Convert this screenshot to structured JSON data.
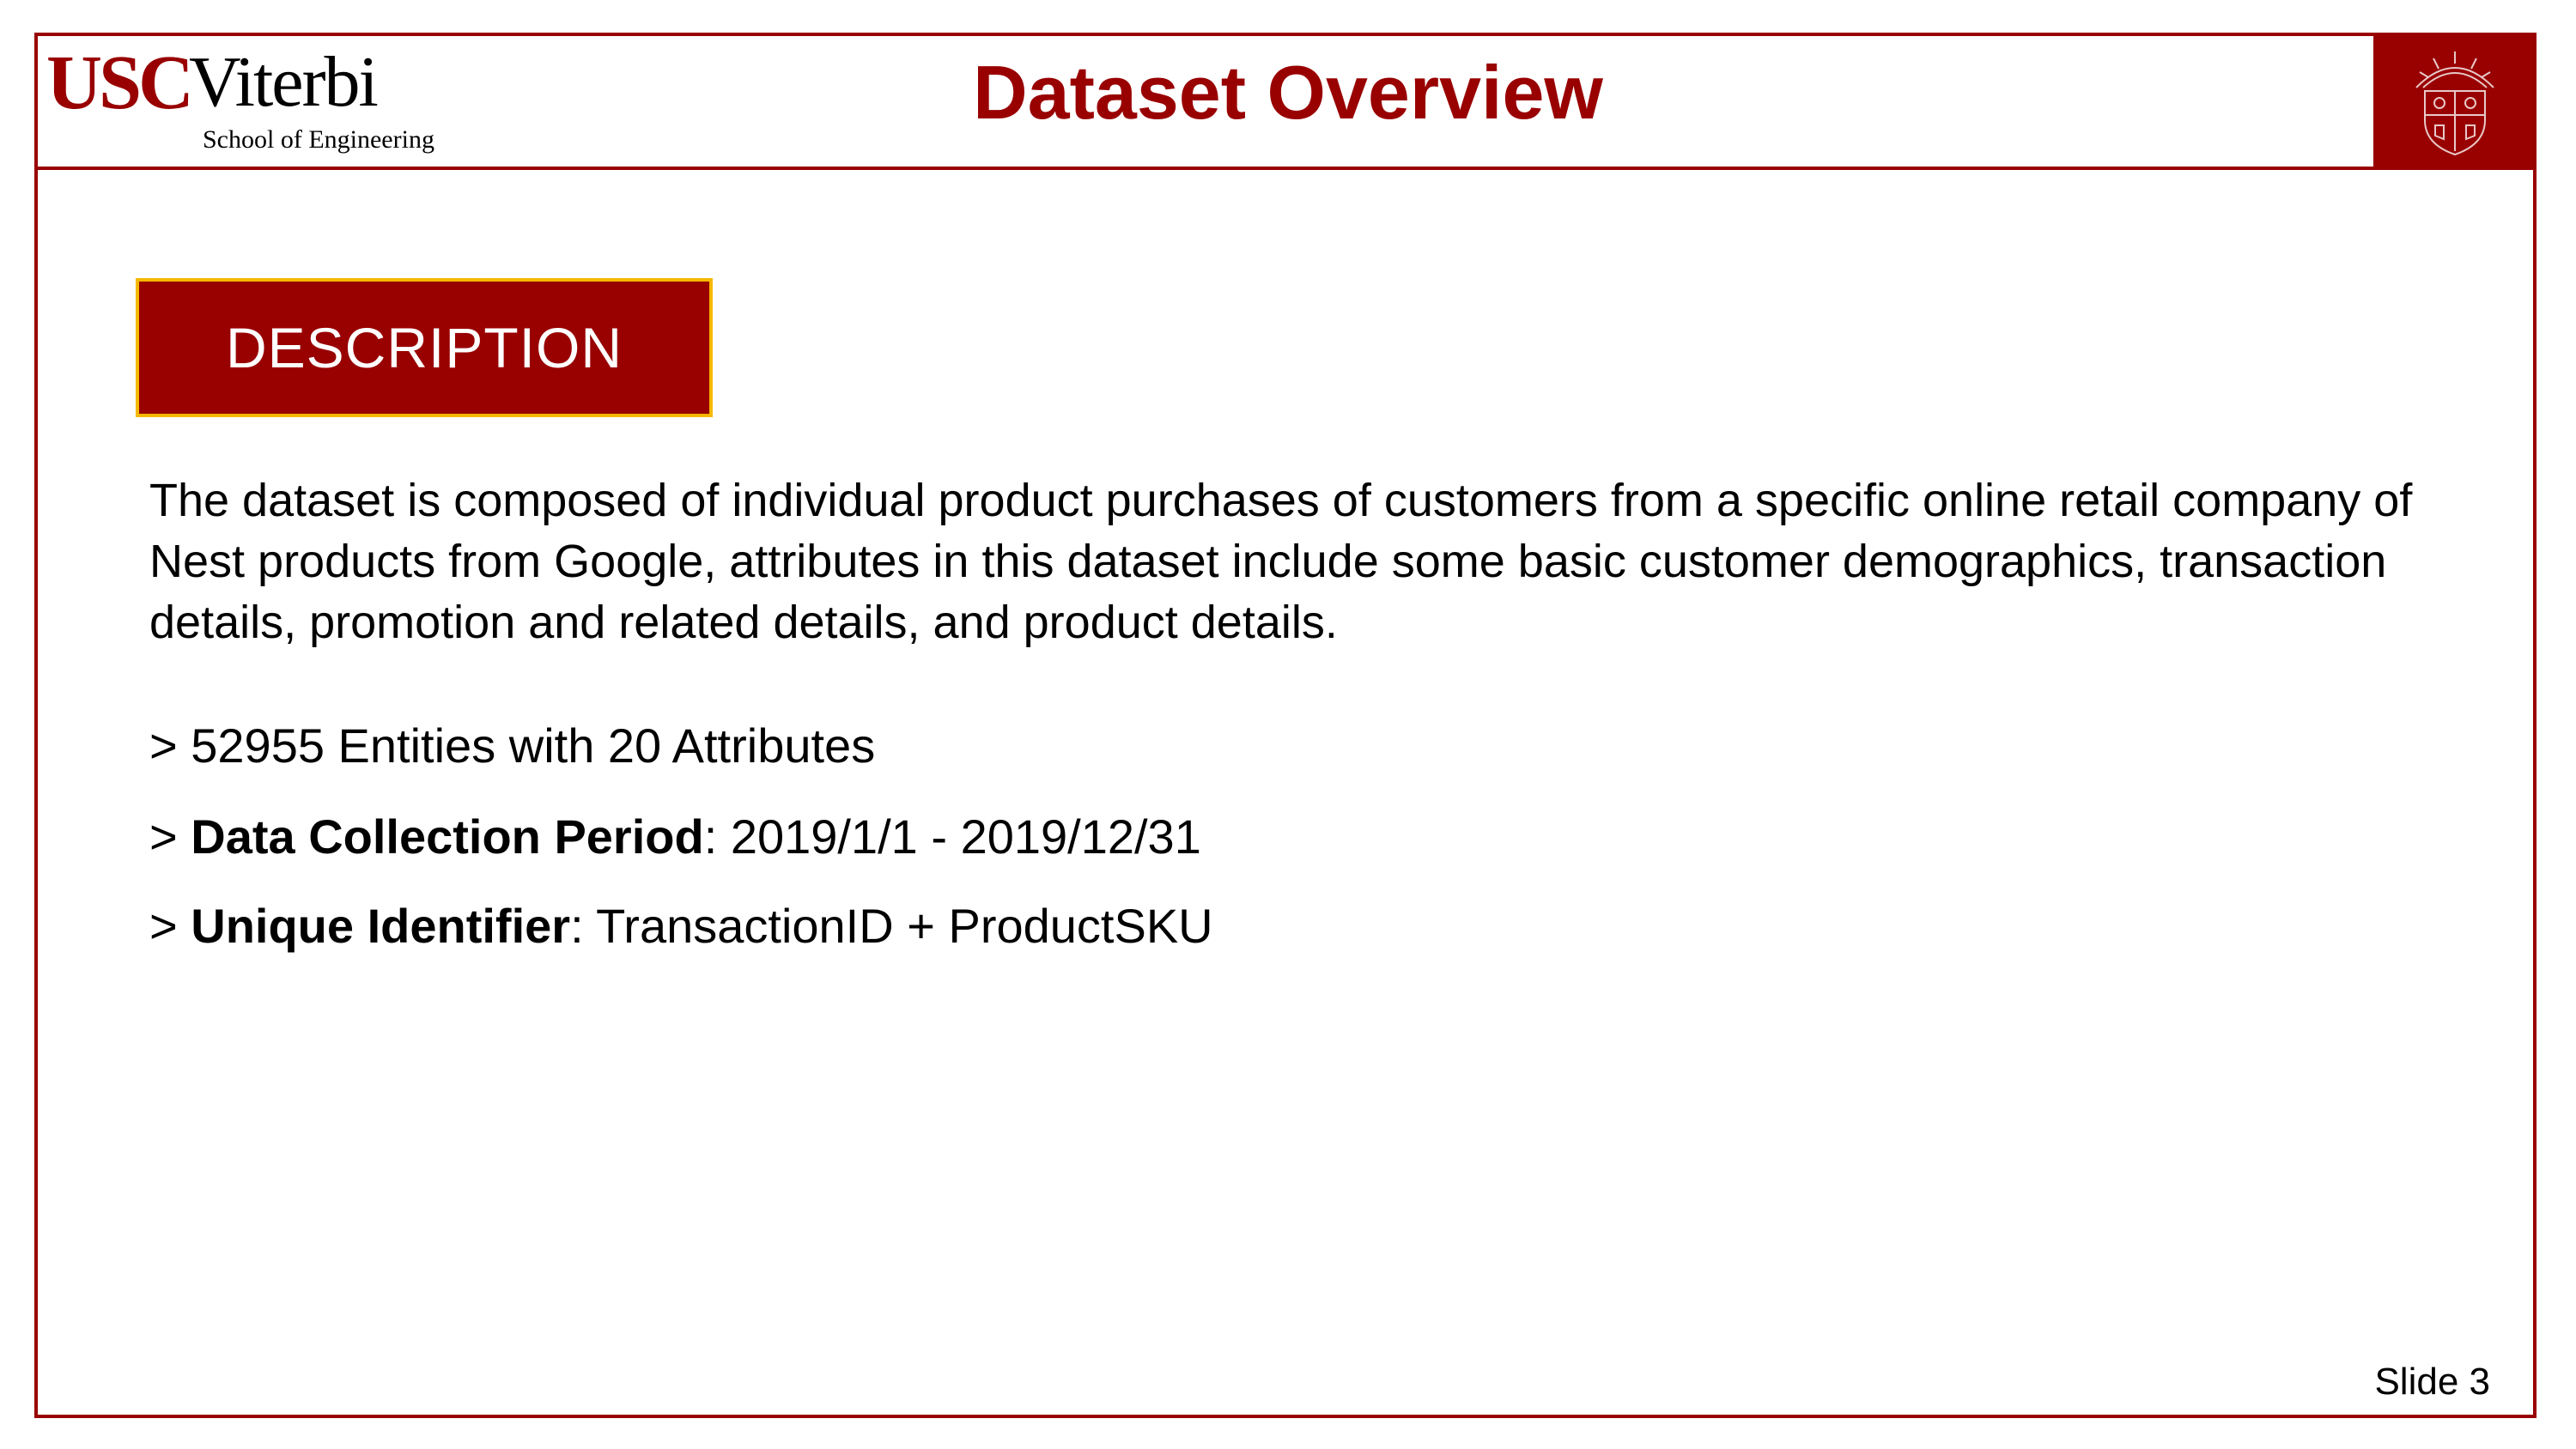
{
  "logo": {
    "usc": "USC",
    "viterbi": "Viterbi",
    "subtitle": "School of Engineering"
  },
  "slide": {
    "title": "Dataset Overview",
    "section_label": "DESCRIPTION",
    "description": "The dataset is composed of individual product purchases of customers from a specific online retail company of Nest products from Google, attributes in this dataset include some basic customer demographics, transaction details, promotion and related details, and product details.",
    "bullets": [
      {
        "prefix": "> ",
        "label": "",
        "text": "52955 Entities with 20 Attributes"
      },
      {
        "prefix": "> ",
        "label": "Data Collection Period",
        "text": ": 2019/1/1 - 2019/12/31"
      },
      {
        "prefix": "> ",
        "label": "Unique Identifier",
        "text": ": TransactionID + ProductSKU"
      }
    ],
    "slide_number": "Slide 3"
  },
  "colors": {
    "brand_red": "#990000",
    "gold": "#f5b800"
  },
  "icons": {
    "seal": "usc-seal-icon"
  }
}
